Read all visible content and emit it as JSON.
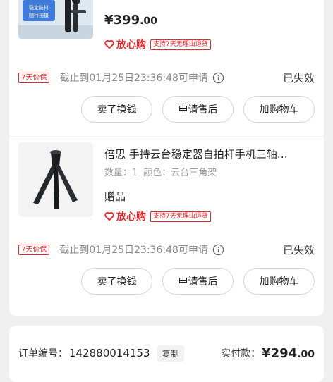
{
  "items": [
    {
      "price_main": "¥399",
      "price_cents": ".00",
      "assure_label": "放心购",
      "assure_tag": "支持7天无理由退货",
      "img_caption_1": "稳定防抖",
      "img_caption_2": "随行拍摄",
      "protect_tag": "7天价保",
      "deadline": "截止到01月25日23:36:48可申请",
      "status": "已失效",
      "buttons": [
        "卖了换钱",
        "申请售后",
        "加购物车"
      ]
    },
    {
      "title": "倍思 手持云台稳定器自拍杆手机三轴…",
      "qty_label": "数量：1",
      "color_label": "颜色：云台三角架",
      "gift_label": "赠品",
      "assure_label": "放心购",
      "assure_tag": "支持7天无理由退货",
      "protect_tag": "7天价保",
      "deadline": "截止到01月25日23:36:48可申请",
      "status": "已失效",
      "buttons": [
        "卖了换钱",
        "申请售后",
        "加购物车"
      ]
    }
  ],
  "order": {
    "no_label": "订单编号：",
    "no_value": "142880014153",
    "copy_label": "复制",
    "paid_label": "实付款：",
    "paid_main": "¥294",
    "paid_cents": ".00"
  },
  "colors": {
    "accent_red": "#e8272d",
    "background": "#efefef",
    "card": "#ffffff"
  }
}
